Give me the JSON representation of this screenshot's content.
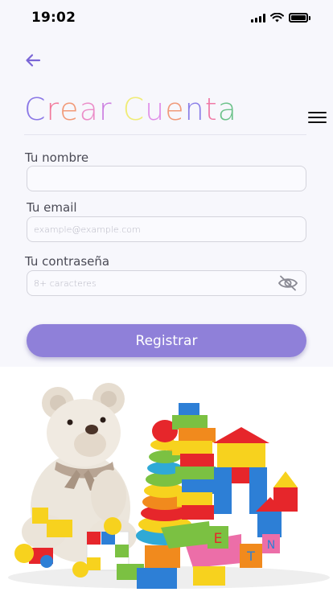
{
  "status_bar": {
    "time": "19:02"
  },
  "title": {
    "letters": [
      {
        "char": "C",
        "color": "#8b78e6"
      },
      {
        "char": "r",
        "color": "#f2789a"
      },
      {
        "char": "e",
        "color": "#f29a78"
      },
      {
        "char": "a",
        "color": "#eb8cc8"
      },
      {
        "char": "r",
        "color": "#cc7ee0"
      },
      {
        "char": " ",
        "color": "#ffffff"
      },
      {
        "char": "C",
        "color": "#f0ec78"
      },
      {
        "char": "u",
        "color": "#e08ee8"
      },
      {
        "char": "e",
        "color": "#f09a7a"
      },
      {
        "char": "n",
        "color": "#8a7ee8"
      },
      {
        "char": "t",
        "color": "#f07aa6"
      },
      {
        "char": "a",
        "color": "#6cc28a"
      }
    ]
  },
  "form": {
    "name_label": "Tu nombre",
    "name_value": "",
    "email_label": "Tu email",
    "email_placeholder": "example@example.com",
    "password_label": "Tu contraseña",
    "password_placeholder": "8+ caracteres",
    "submit_label": "Registrar"
  },
  "colors": {
    "accent": "#8f80d9",
    "back_arrow": "#7a66d6",
    "background": "#f7f7fc"
  },
  "icons": [
    "signal-icon",
    "wifi-icon",
    "battery-icon",
    "back-arrow-icon",
    "menu-icon",
    "eye-slash-icon"
  ],
  "hero_image": {
    "subject": "toys-illustration"
  }
}
